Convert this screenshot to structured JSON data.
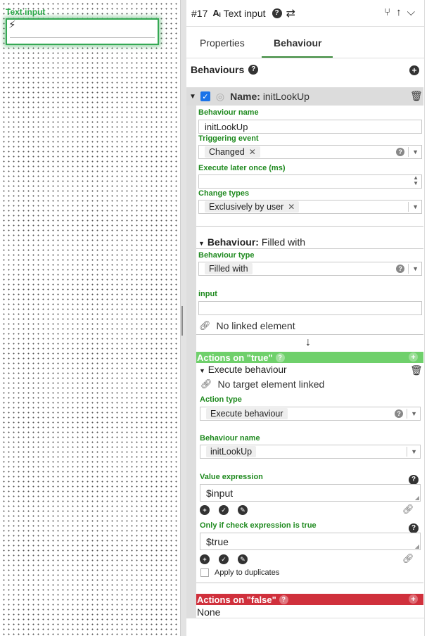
{
  "canvas": {
    "widget_label": "Text input"
  },
  "header": {
    "element_number": "#17",
    "element_type": "Text input"
  },
  "tabs": [
    {
      "label": "Properties"
    },
    {
      "label": "Behaviour"
    }
  ],
  "behaviours_title": "Behaviours",
  "behaviour": {
    "name_prefix": "Name:",
    "name": "initLookUp",
    "fields": {
      "behaviour_name_label": "Behaviour name",
      "behaviour_name_value": "initLookUp",
      "triggering_event_label": "Triggering event",
      "triggering_event_value": "Changed",
      "execute_later_label": "Execute later once (ms)",
      "execute_later_value": "",
      "change_types_label": "Change types",
      "change_types_value": "Exclusively by user"
    },
    "section_prefix": "Behaviour:",
    "section_value": "Filled with",
    "behaviour_type_label": "Behaviour type",
    "behaviour_type_value": "Filled with",
    "input_label": "input",
    "input_value": "",
    "no_linked": "No linked element"
  },
  "actions_true": {
    "title": "Actions on \"true\"",
    "action_title": "Execute behaviour",
    "no_target": "No target element linked",
    "action_type_label": "Action type",
    "action_type_value": "Execute behaviour",
    "behaviour_name_label": "Behaviour name",
    "behaviour_name_value": "initLookUp",
    "value_expression_label": "Value expression",
    "value_expression_value": "$input",
    "check_expression_label": "Only if check expression is true",
    "check_expression_value": "$true",
    "apply_duplicates_label": "Apply to duplicates"
  },
  "actions_false": {
    "title": "Actions on \"false\"",
    "none": "None"
  },
  "colors": {
    "green_bar": "#6fd06b",
    "red_bar": "#d0303c",
    "label_green": "#1f8a1f",
    "accent_blue": "#1a73e8"
  }
}
